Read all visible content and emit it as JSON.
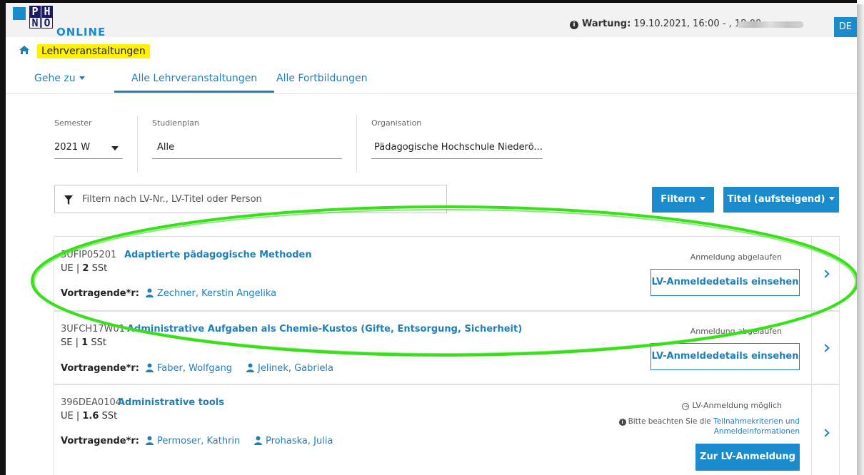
{
  "header": {
    "logo_letters": [
      "P",
      "H",
      "N",
      "Ö"
    ],
    "logo_word": "ONLINE",
    "maintenance_label": "Wartung:",
    "maintenance_value": "19.10.2021, 16:00 - , 18:00",
    "language": "DE",
    "brand_color": "#1a8ccd"
  },
  "breadcrumb": {
    "title": "Lehrveranstaltungen",
    "highlight_color": "#fff200"
  },
  "tabs": [
    {
      "label": "Gehe zu"
    },
    {
      "label": "Alle Lehrveranstaltungen",
      "active": true
    },
    {
      "label": "Alle Fortbildungen"
    }
  ],
  "filters": {
    "semester": {
      "label": "Semester",
      "value": "2021 W"
    },
    "studienplan": {
      "label": "Studienplan",
      "value": "Alle"
    },
    "organisation": {
      "label": "Organisation",
      "value": "Pädagogische Hochschule Niederö..."
    },
    "search_placeholder": "Filtern nach LV-Nr., LV-Titel oder Person",
    "filter_button": "Filtern",
    "sort_button": "Titel (aufsteigend)"
  },
  "courses": [
    {
      "code": "3UFIP05201",
      "title": "Adaptierte pädagogische Methoden",
      "type": "UE",
      "sst": "2",
      "sst_unit": "SSt",
      "lecturers_label": "Vortragende*r:",
      "lecturers": [
        "Zechner, Kerstin Angelika"
      ],
      "status": "Anmeldung abgelaufen",
      "action": "LV-Anmeldedetails einsehen"
    },
    {
      "code": "3UFCH17W01",
      "title": "Administrative Aufgaben als Chemie-Kustos (Gifte, Entsorgung, Sicherheit)",
      "type": "SE",
      "sst": "1",
      "sst_unit": "SSt",
      "lecturers_label": "Vortragende*r:",
      "lecturers": [
        "Faber, Wolfgang",
        "Jelinek, Gabriela"
      ],
      "status": "Anmeldung abgelaufen",
      "action": "LV-Anmeldedetails einsehen"
    },
    {
      "code": "396DEA0104",
      "title": "Administrative tools",
      "type": "UE",
      "sst": "1.6",
      "sst_unit": "SSt",
      "lecturers_label": "Vortragende*r:",
      "lecturers": [
        "Permoser, Kathrin",
        "Prohaska, Julia"
      ],
      "status": "LV-Anmeldung möglich",
      "note_prefix": "Bitte beachten Sie die",
      "note_link": "Teilnahmekriterien und Anmeldeinformationen",
      "action": "Zur LV-Anmeldung"
    }
  ],
  "annotation": {
    "color": "#39e01a"
  }
}
